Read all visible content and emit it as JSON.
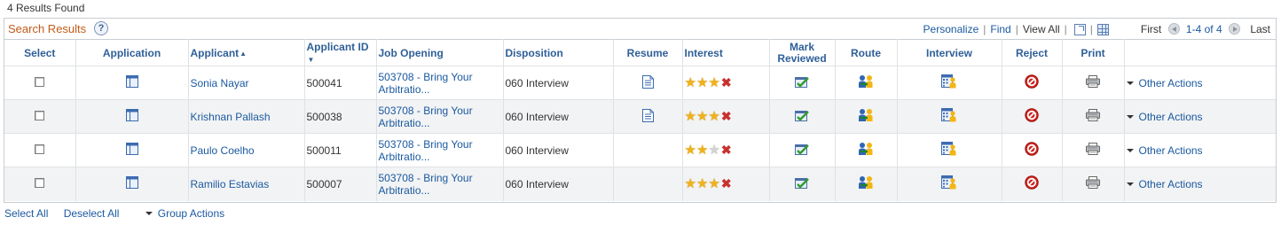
{
  "results_found": "4 Results Found",
  "grid": {
    "title": "Search Results",
    "help_label": "?",
    "tools": {
      "personalize": "Personalize",
      "find": "Find",
      "view_all": "View All",
      "sep": "|"
    },
    "pager": {
      "first": "First",
      "range": "1-4 of 4",
      "last": "Last"
    }
  },
  "columns": {
    "select": "Select",
    "application": "Application",
    "applicant": "Applicant",
    "applicant_id": "Applicant ID",
    "job_opening": "Job Opening",
    "disposition": "Disposition",
    "resume": "Resume",
    "interest": "Interest",
    "mark_reviewed_1": "Mark",
    "mark_reviewed_2": "Reviewed",
    "route": "Route",
    "interview": "Interview",
    "reject": "Reject",
    "print": "Print"
  },
  "rows": [
    {
      "applicant": "Sonia Nayar",
      "applicant_id": "500041",
      "job_opening_1": "503708 - Bring Your",
      "job_opening_2": "Arbitratio...",
      "disposition": "060 Interview",
      "has_resume": true,
      "stars": 3,
      "other_actions": "Other Actions"
    },
    {
      "applicant": "Krishnan Pallash",
      "applicant_id": "500038",
      "job_opening_1": "503708 - Bring Your",
      "job_opening_2": "Arbitratio...",
      "disposition": "060 Interview",
      "has_resume": true,
      "stars": 3,
      "other_actions": "Other Actions"
    },
    {
      "applicant": "Paulo Coelho",
      "applicant_id": "500011",
      "job_opening_1": "503708 - Bring Your",
      "job_opening_2": "Arbitratio...",
      "disposition": "060 Interview",
      "has_resume": false,
      "stars": 2,
      "other_actions": "Other Actions"
    },
    {
      "applicant": "Ramilio Estavias",
      "applicant_id": "500007",
      "job_opening_1": "503708 - Bring Your",
      "job_opening_2": "Arbitratio...",
      "disposition": "060 Interview",
      "has_resume": false,
      "stars": 3,
      "other_actions": "Other Actions"
    }
  ],
  "footer": {
    "select_all": "Select All",
    "deselect_all": "Deselect All",
    "group_actions": "Group Actions"
  },
  "icons": {
    "application": "application-window-icon",
    "resume": "document-icon",
    "interest_star": "star-icon",
    "interest_clear": "red-x-icon",
    "mark_reviewed": "checkmark-reviewed-icon",
    "route": "route-people-icon",
    "interview": "interview-calendar-icon",
    "reject": "reject-no-entry-icon",
    "print": "printer-icon"
  },
  "colors": {
    "title": "#c45b1a",
    "link": "#1b5aa0",
    "header_text": "#2f5f98",
    "alt_row": "#f2f3f4",
    "star": "#f0b21a",
    "reject": "#d0241d"
  }
}
